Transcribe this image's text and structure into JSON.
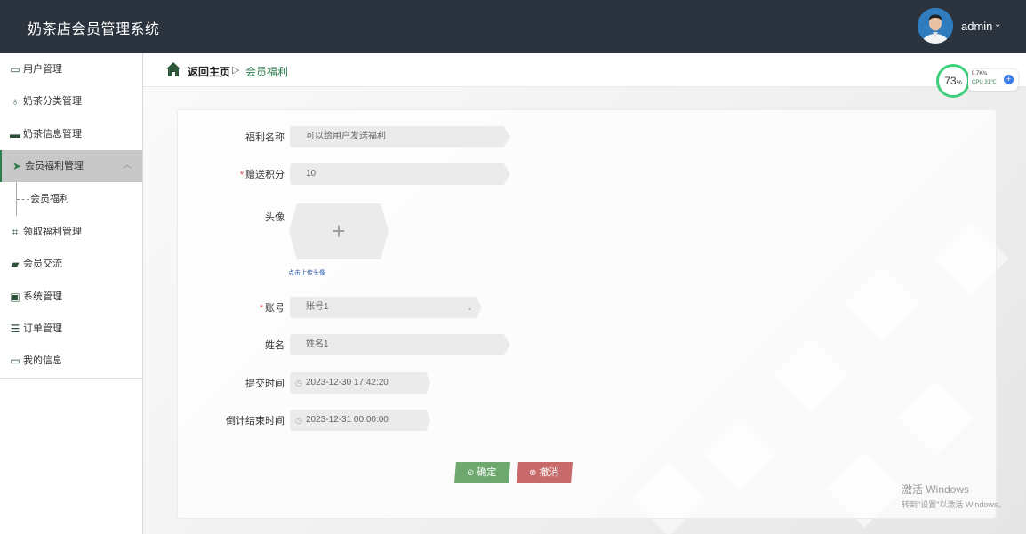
{
  "header": {
    "title": "奶茶店会员管理系统",
    "user": "admin"
  },
  "sidebar": {
    "items": [
      {
        "label": "用户管理"
      },
      {
        "label": "奶茶分类管理"
      },
      {
        "label": "奶茶信息管理"
      },
      {
        "label": "会员福利管理"
      },
      {
        "label": "领取福利管理"
      },
      {
        "label": "会员交流"
      },
      {
        "label": "系统管理"
      },
      {
        "label": "订单管理"
      },
      {
        "label": "我的信息"
      }
    ],
    "sub_items": [
      {
        "label": "会员福利"
      }
    ]
  },
  "breadcrumb": {
    "home": "返回主页",
    "separator": "▷",
    "current": "会员福利"
  },
  "monitor": {
    "percent": "73",
    "percent_unit": "%",
    "net": "0.7K/s",
    "cpu_label": "CPU",
    "cpu_temp": "31℃"
  },
  "form": {
    "fields": {
      "welfare_name": {
        "label": "福利名称",
        "placeholder": "可以给用户发送福利"
      },
      "points": {
        "label": "赠送积分",
        "value": "10"
      },
      "avatar": {
        "label": "头像",
        "hint": "点击上传头像",
        "plus": "+"
      },
      "account": {
        "label": "账号",
        "value": "账号1"
      },
      "name": {
        "label": "姓名",
        "value": "姓名1"
      },
      "submit_time": {
        "label": "提交时间",
        "value": "2023-12-30 17:42:20"
      },
      "end_time": {
        "label": "倒计结束时间",
        "value": "2023-12-31 00:00:00"
      }
    },
    "required_mark": "*",
    "confirm_label": "确定",
    "cancel_label": "撤消"
  },
  "watermark": {
    "line1": "激活 Windows",
    "line2": "转到\"设置\"以激活 Windows。"
  },
  "colors": {
    "header_bg": "#2b333e",
    "accent": "#2e7d4f",
    "confirm": "#6fa86f",
    "cancel": "#c96a6a"
  }
}
